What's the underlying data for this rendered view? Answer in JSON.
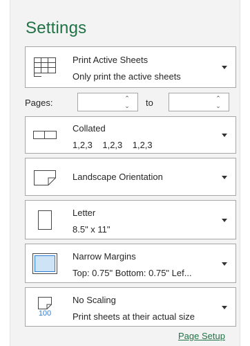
{
  "settings": {
    "title": "Settings",
    "print_what": {
      "label": "Print Active Sheets",
      "description": "Only print the active sheets"
    },
    "pages": {
      "label": "Pages:",
      "from_value": "",
      "to_label": "to",
      "to_value": ""
    },
    "collation": {
      "label": "Collated",
      "description": "1,2,3    1,2,3    1,2,3"
    },
    "orientation": {
      "label": "Landscape Orientation"
    },
    "paper": {
      "label": "Letter",
      "description": "8.5\" x 11\""
    },
    "margins": {
      "label": "Narrow Margins",
      "description": "Top: 0.75\" Bottom: 0.75\" Lef..."
    },
    "scaling": {
      "label": "No Scaling",
      "description": "Print sheets at their actual size",
      "icon_text": "100"
    },
    "page_setup_link": "Page Setup"
  },
  "colors": {
    "accent": "#217346",
    "scaling_icon": "#2b7cd3",
    "margins_icon": "#2b7cd3"
  },
  "icons": {
    "print_what": "sheet-grid-icon",
    "collation": "collated-pages-icon",
    "orientation": "landscape-page-icon",
    "paper": "portrait-page-icon",
    "margins": "margins-icon",
    "scaling": "scaling-icon",
    "spin_up": "caret-up-icon",
    "spin_down": "caret-down-icon",
    "dropdown": "chevron-down-icon"
  }
}
